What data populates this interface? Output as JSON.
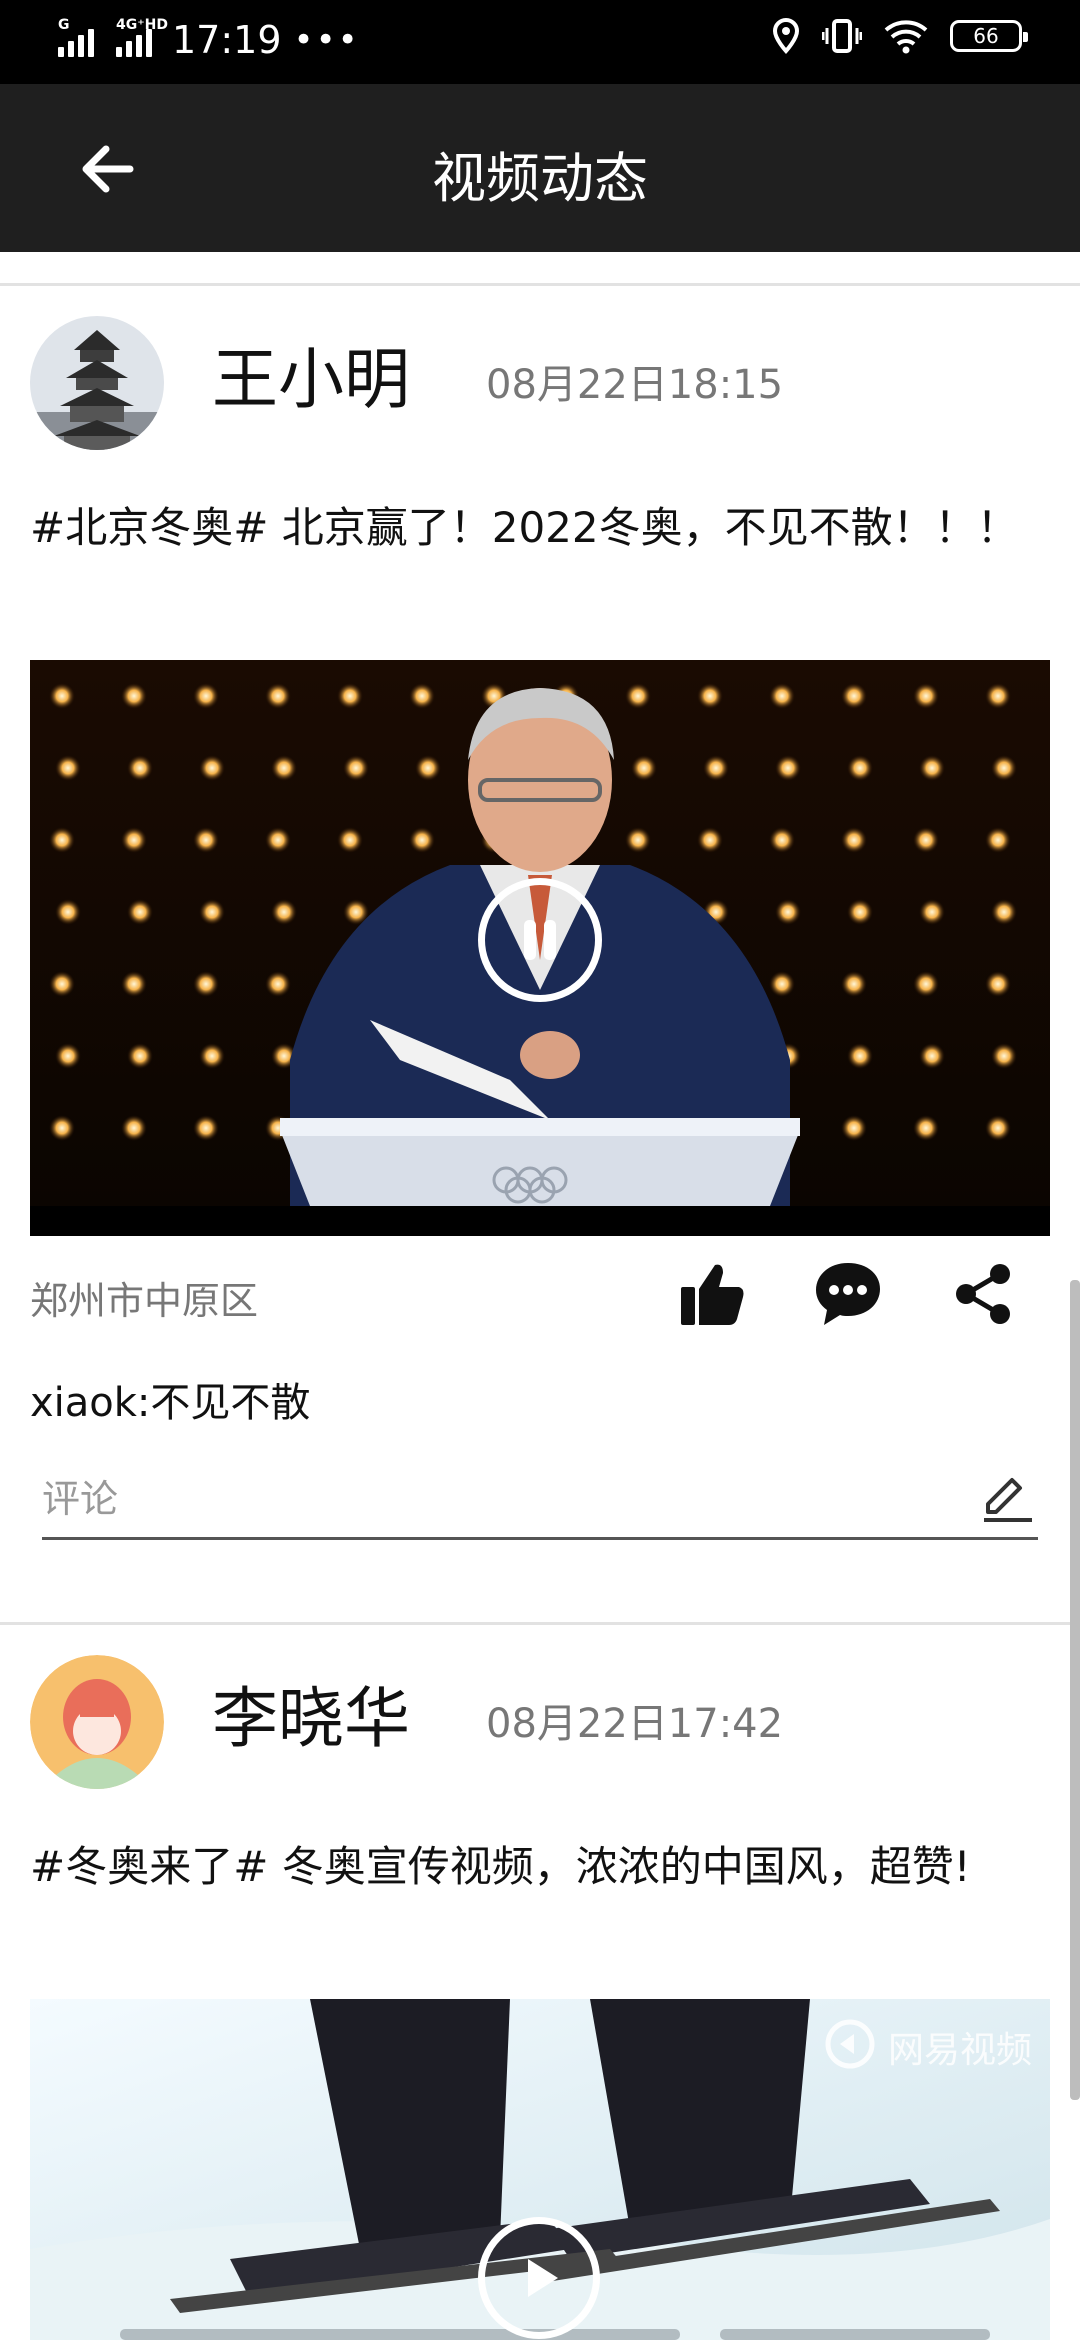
{
  "status_bar": {
    "signal1_tag": "G",
    "signal2_tag": "4G⁺HD",
    "time": "17:19",
    "dots": "•••",
    "battery": "66"
  },
  "header": {
    "title": "视频动态"
  },
  "posts": [
    {
      "username": "王小明",
      "time": "08月22日18:15",
      "text": "#北京冬奥# 北京赢了！2022冬奥，不见不散！！！",
      "location": "郑州市中原区",
      "comment": "xiaok:不见不散",
      "comment_placeholder": "评论",
      "video_state": "playing"
    },
    {
      "username": "李晓华",
      "time": "08月22日17:42",
      "text": "#冬奥来了# 冬奥宣传视频，浓浓的中国风，超赞!",
      "watermark": "网易视频",
      "video_state": "paused"
    }
  ],
  "icons": [
    "back-arrow-icon",
    "like-icon",
    "comment-icon",
    "share-icon",
    "edit-icon",
    "pause-icon",
    "play-icon",
    "location-icon",
    "vibrate-icon",
    "wifi-icon"
  ],
  "colors": {
    "header_bg": "#1f1f1f",
    "status_bg": "#000000",
    "secondary_text": "#777777"
  }
}
